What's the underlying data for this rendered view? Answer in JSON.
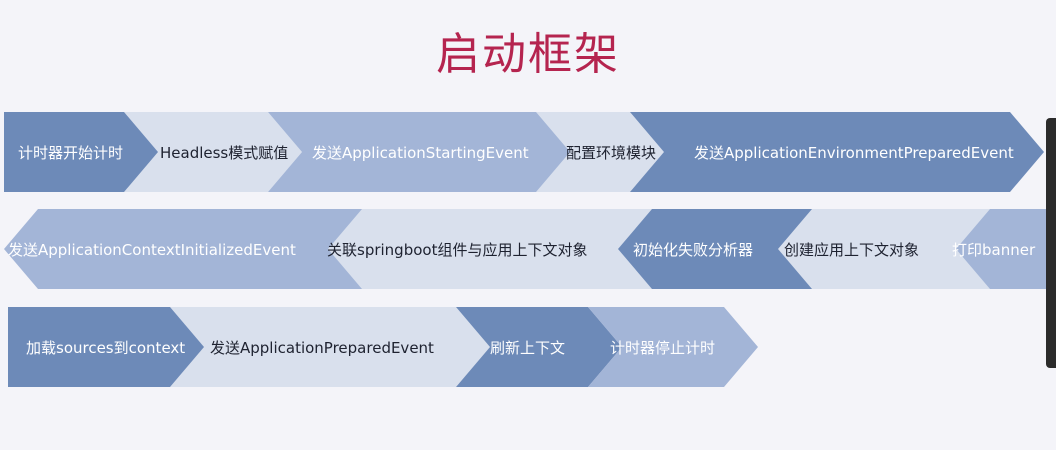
{
  "title": "启动框架",
  "colors": {
    "title": "#b5244f",
    "dark_blue": "#6d8ab8",
    "mid_blue": "#a3b5d7",
    "pale_blue": "#d9e0ed",
    "background": "#f4f4f9"
  },
  "rows": [
    {
      "direction": "right",
      "steps": [
        {
          "label": "计时器开始计时",
          "tone": "dark"
        },
        {
          "label": "Headless模式赋值",
          "tone": "pale"
        },
        {
          "label": "发送ApplicationStartingEvent",
          "tone": "mid"
        },
        {
          "label": "配置环境模块",
          "tone": "pale"
        },
        {
          "label": "发送ApplicationEnvironmentPreparedEvent",
          "tone": "dark"
        }
      ]
    },
    {
      "direction": "left",
      "steps": [
        {
          "label": "打印banner",
          "tone": "mid"
        },
        {
          "label": "创建应用上下文对象",
          "tone": "pale"
        },
        {
          "label": "初始化失败分析器",
          "tone": "dark"
        },
        {
          "label": "关联springboot组件与应用上下文对象",
          "tone": "pale"
        },
        {
          "label": "发送ApplicationContextInitializedEvent",
          "tone": "mid"
        }
      ]
    },
    {
      "direction": "right",
      "steps": [
        {
          "label": "加载sources到context",
          "tone": "dark"
        },
        {
          "label": "发送ApplicationPreparedEvent",
          "tone": "pale"
        },
        {
          "label": "刷新上下文",
          "tone": "dark"
        },
        {
          "label": "计时器停止计时",
          "tone": "mid"
        }
      ]
    }
  ]
}
